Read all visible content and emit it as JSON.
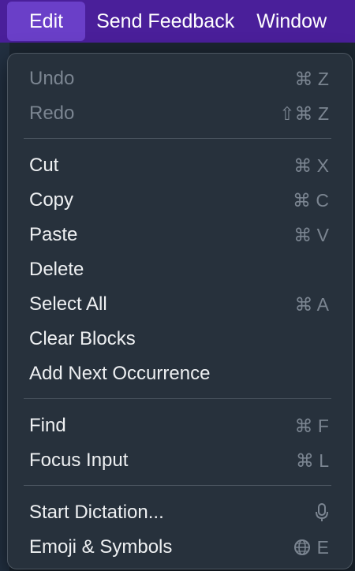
{
  "menubar": {
    "items": [
      "Edit",
      "Send Feedback",
      "Window"
    ]
  },
  "menu": {
    "items": [
      {
        "label": "Undo",
        "shortcut": "⌘ Z",
        "disabled": true
      },
      {
        "label": "Redo",
        "shortcut": "⇧⌘ Z",
        "disabled": true
      },
      {
        "label": "Cut",
        "shortcut": "⌘ X",
        "disabled": false
      },
      {
        "label": "Copy",
        "shortcut": "⌘ C",
        "disabled": false
      },
      {
        "label": "Paste",
        "shortcut": "⌘ V",
        "disabled": false
      },
      {
        "label": "Delete",
        "shortcut": "",
        "disabled": false
      },
      {
        "label": "Select All",
        "shortcut": "⌘ A",
        "disabled": false
      },
      {
        "label": "Clear Blocks",
        "shortcut": "",
        "disabled": false
      },
      {
        "label": "Add Next Occurrence",
        "shortcut": "",
        "disabled": false
      },
      {
        "label": "Find",
        "shortcut": "⌘ F",
        "disabled": false
      },
      {
        "label": "Focus Input",
        "shortcut": "⌘ L",
        "disabled": false
      },
      {
        "label": "Start Dictation...",
        "shortcut_icon": "microphone-icon",
        "disabled": false
      },
      {
        "label": "Emoji & Symbols",
        "shortcut_icon": "globe-icon",
        "shortcut": "E",
        "disabled": false
      }
    ]
  },
  "colors": {
    "menubar_bg": "#4a1f9a",
    "menubar_active": "#6a3fc8",
    "menu_bg": "#27313c",
    "text": "#eef0f2",
    "disabled_text": "#7b8591"
  }
}
